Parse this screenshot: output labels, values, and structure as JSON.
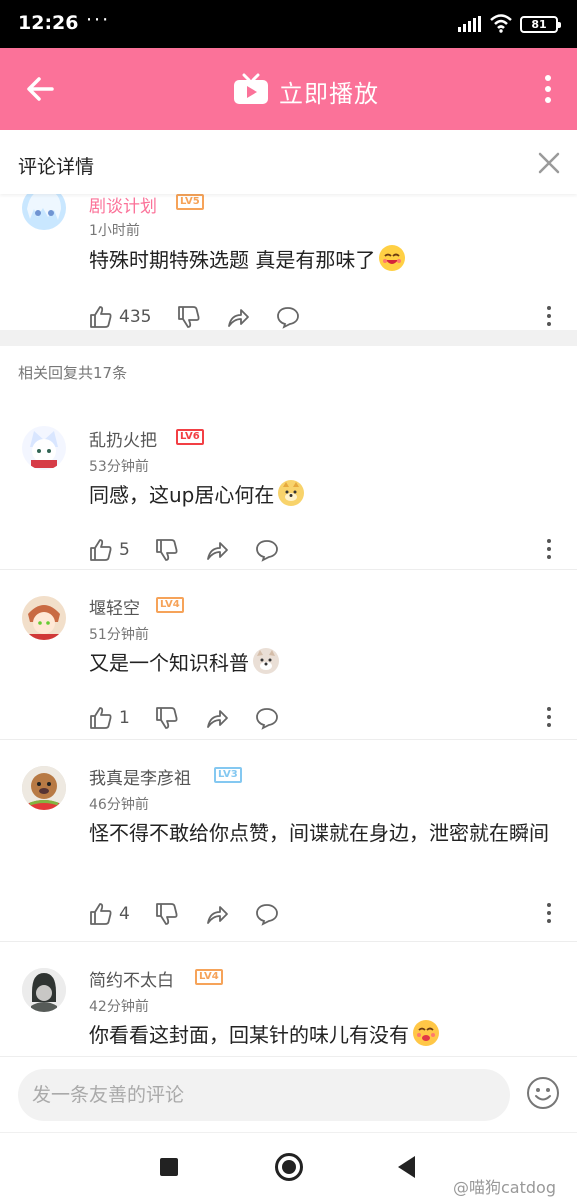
{
  "status_bar": {
    "time": "12:26",
    "dots": "···",
    "battery": "81"
  },
  "app_bar": {
    "title": "立即播放",
    "accent_color": "#fb7299",
    "icons": [
      "back-arrow-icon",
      "tv-icon",
      "more-vertical-icon"
    ]
  },
  "sheet": {
    "title": "评论详情",
    "close_icon": "close-icon"
  },
  "top_comment": {
    "name": "剧谈计划",
    "level": "LV5",
    "time": "1小时前",
    "content": "特殊时期特殊选题 真是有那味了",
    "likes": "435"
  },
  "reply_count": "相关回复共17条",
  "replies": [
    {
      "name": "乱扔火把",
      "level": "LV6",
      "level_color": "#f23f44",
      "time": "53分钟前",
      "content": "同感，这up居心何在",
      "likes": "5"
    },
    {
      "name": "堰轻空",
      "level": "LV4",
      "level_color": "#f6a359",
      "time": "51分钟前",
      "content": "又是一个知识科普",
      "likes": "1"
    },
    {
      "name": "我真是李彦祖",
      "level": "LV3",
      "level_color": "#84c8f1",
      "time": "46分钟前",
      "content": "怪不得不敢给你点赞，间谍就在身边，泄密就在瞬间",
      "likes": "4"
    },
    {
      "name": "简约不太白",
      "level": "LV4",
      "level_color": "#f6a359",
      "time": "42分钟前",
      "content": "你看看这封面，回某针的味儿有没有",
      "likes": ""
    }
  ],
  "input_bar": {
    "placeholder": "发一条友善的评论"
  },
  "watermark": "@喵狗catdog"
}
